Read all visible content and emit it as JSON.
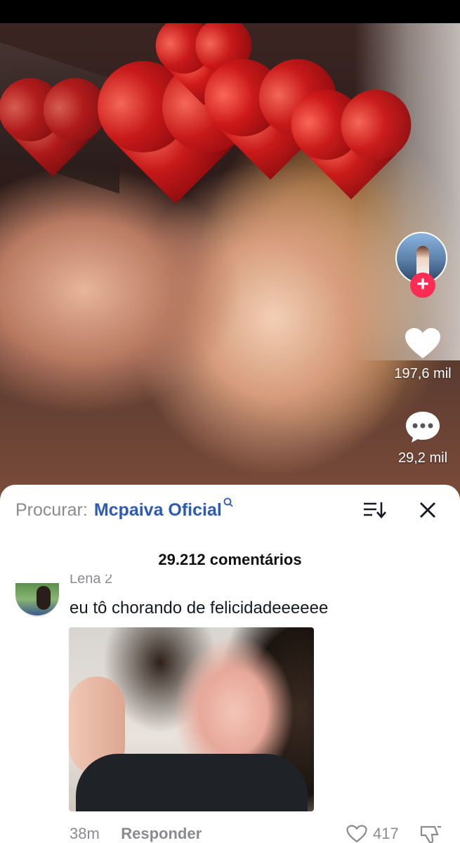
{
  "video": {
    "likes": "197,6 mil",
    "comments": "29,2 mil"
  },
  "comments_sheet": {
    "search_prefix": "Procurar:",
    "search_term": "Mcpaiva Oficial",
    "comment_count_label": "29.212 comentários",
    "comment": {
      "username": "Lena 2",
      "text": "eu tô chorando de felicidadeeeeee",
      "time": "38m",
      "reply_label": "Responder",
      "likes": "417"
    }
  },
  "colors": {
    "accent": "#fe2c55",
    "link": "#2b5bb4",
    "muted": "#8a8b91"
  },
  "icons": [
    "plus-icon",
    "heart-icon",
    "comment-bubble-icon",
    "search-icon",
    "sort-icon",
    "close-icon",
    "heart-outline-icon",
    "dislike-icon"
  ]
}
